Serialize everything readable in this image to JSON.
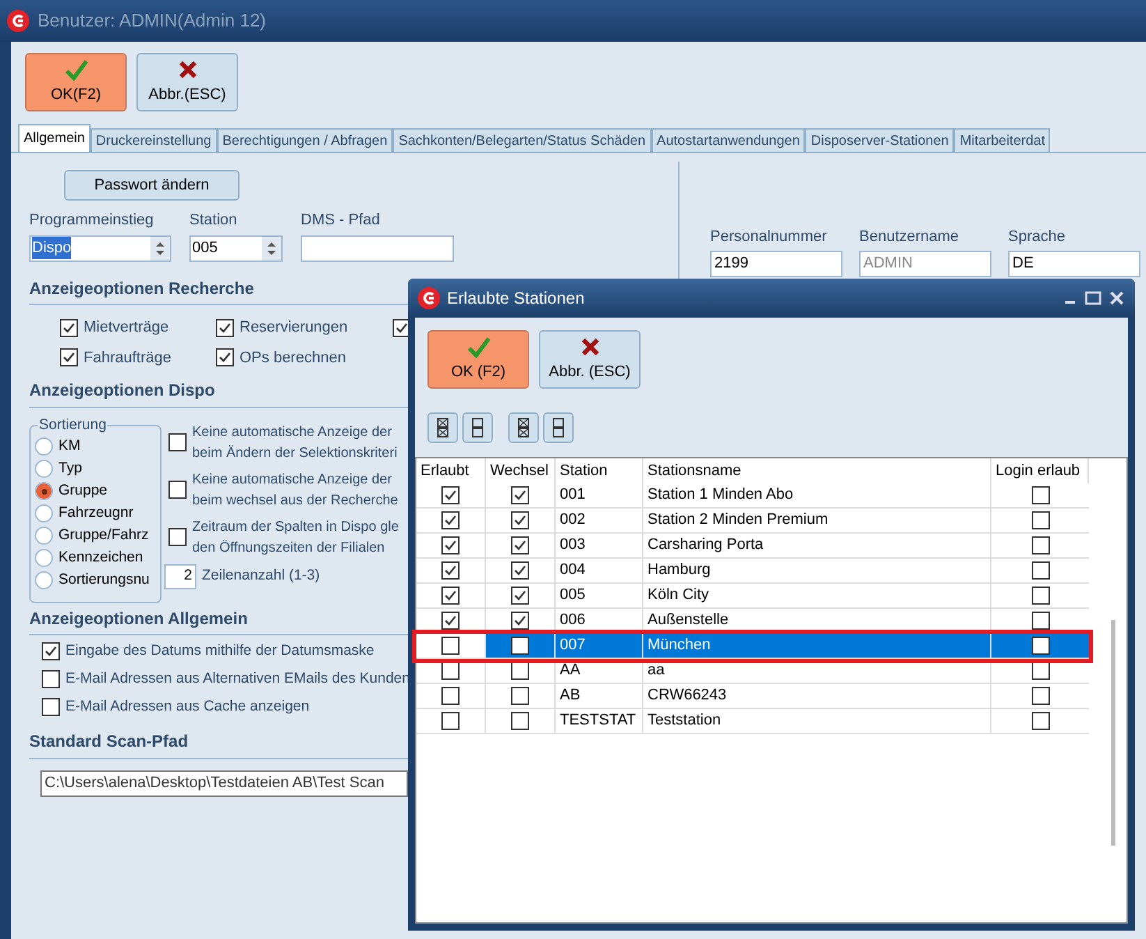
{
  "window": {
    "title": "Benutzer: ADMIN(Admin 12)"
  },
  "toolbar": [
    {
      "label": "OK(F2)",
      "kind": "ok"
    },
    {
      "label": "Abbr.(ESC)",
      "kind": "cancel"
    }
  ],
  "tabs": [
    {
      "label": "Allgemein",
      "selected": true
    },
    {
      "label": "Druckereinstellung",
      "selected": false
    },
    {
      "label": "Berechtigungen / Abfragen",
      "selected": false
    },
    {
      "label": "Sachkonten/Belegarten/Status Schäden",
      "selected": false
    },
    {
      "label": "Autostartanwendungen",
      "selected": false
    },
    {
      "label": "Disposerver-Stationen",
      "selected": false
    },
    {
      "label": "Mitarbeiterdat",
      "selected": false
    }
  ],
  "password_button": "Passwort ändern",
  "fields": [
    {
      "label": "Programmeinstieg",
      "value": "Dispo",
      "kind": "spin",
      "highlighted": true
    },
    {
      "label": "Station",
      "value": "005",
      "kind": "spin",
      "highlighted": false
    },
    {
      "label": "DMS - Pfad",
      "kind": "text",
      "highlighted": false
    }
  ],
  "recherche": {
    "heading": "Anzeigeoptionen Recherche",
    "options": [
      {
        "label": "Mietverträge",
        "checked": true
      },
      {
        "label": "Reservierungen",
        "checked": true
      },
      {
        "checked": true
      },
      {
        "label": "Fahraufträge",
        "checked": true
      },
      {
        "label": "OPs berechnen",
        "checked": true
      }
    ]
  },
  "dispo": {
    "heading": "Anzeigeoptionen Dispo",
    "sort_group": {
      "title": "Sortierung",
      "options": [
        {
          "label": "KM",
          "selected": false
        },
        {
          "label": "Typ",
          "selected": false
        },
        {
          "label": "Gruppe",
          "selected": true
        },
        {
          "label": "Fahrzeugnr",
          "selected": false
        },
        {
          "label": "Gruppe/Fahrz",
          "selected": false
        },
        {
          "label": "Kennzeichen",
          "selected": false
        },
        {
          "label": "Sortierungsnu",
          "selected": false
        }
      ]
    },
    "options": [
      {
        "lines": [
          "Keine automatische Anzeige der",
          "beim Ändern der Selektionskriteri"
        ],
        "checked": false
      },
      {
        "lines": [
          "Keine automatische Anzeige der",
          "beim wechsel aus der Recherche"
        ],
        "checked": false
      },
      {
        "lines": [
          "Zeitraum der Spalten in Dispo gle",
          "den Öffnungszeiten der Filialen"
        ],
        "checked": false
      }
    ],
    "rows_count": {
      "value": "2",
      "label": "Zeilenanzahl (1-3)"
    }
  },
  "allgemein": {
    "heading": "Anzeigeoptionen Allgemein",
    "options": [
      {
        "label": "Eingabe des Datums mithilfe der Datumsmaske",
        "checked": true
      },
      {
        "label": "E-Mail Adressen aus Alternativen EMails des Kunden",
        "checked": false
      },
      {
        "label": "E-Mail Adressen aus Cache anzeigen",
        "checked": false
      }
    ]
  },
  "scan": {
    "heading": "Standard Scan-Pfad",
    "value": "C:\\Users\\alena\\Desktop\\Testdateien AB\\Test Scan"
  },
  "personal": [
    {
      "label": "Personalnummer",
      "value": "2199",
      "disabled": false
    },
    {
      "label": "Benutzername",
      "value": "ADMIN",
      "disabled": true
    },
    {
      "label": "Sprache",
      "value": "DE",
      "disabled": false
    }
  ],
  "dialog": {
    "title": "Erlaubte Stationen",
    "buttons": [
      {
        "label": "OK (F2)",
        "kind": "ok"
      },
      {
        "label": "Abbr. (ESC)",
        "kind": "cancel"
      }
    ],
    "mark_buttons": [
      {
        "kind": "all"
      },
      {
        "kind": "none"
      },
      {
        "kind": "all"
      },
      {
        "kind": "none"
      }
    ],
    "columns": [
      "Erlaubt",
      "Wechsel",
      "Station",
      "Stationsname",
      "Login erlaub"
    ],
    "rows": [
      {
        "allowed": true,
        "switch": true,
        "station": "001",
        "name": "Station 1 Minden Abo",
        "login": false,
        "selected": false,
        "highlighted": false
      },
      {
        "allowed": true,
        "switch": true,
        "station": "002",
        "name": "Station 2 Minden Premium",
        "login": false,
        "selected": false,
        "highlighted": false
      },
      {
        "allowed": true,
        "switch": true,
        "station": "003",
        "name": "Carsharing Porta",
        "login": false,
        "selected": false,
        "highlighted": false
      },
      {
        "allowed": true,
        "switch": true,
        "station": "004",
        "name": "Hamburg",
        "login": false,
        "selected": false,
        "highlighted": false
      },
      {
        "allowed": true,
        "switch": true,
        "station": "005",
        "name": "Köln City",
        "login": false,
        "selected": false,
        "highlighted": false
      },
      {
        "allowed": true,
        "switch": true,
        "station": "006",
        "name": "Außenstelle",
        "login": false,
        "selected": false,
        "highlighted": false
      },
      {
        "allowed": false,
        "switch": false,
        "station": "007",
        "name": "München",
        "login": false,
        "selected": true,
        "highlighted": true
      },
      {
        "allowed": false,
        "switch": false,
        "station": "AA",
        "name": "aa",
        "login": false,
        "selected": false,
        "highlighted": false
      },
      {
        "allowed": false,
        "switch": false,
        "station": "AB",
        "name": "CRW66243",
        "login": false,
        "selected": false,
        "highlighted": false
      },
      {
        "allowed": false,
        "switch": false,
        "station": "TESTSTAT",
        "name": "Teststation",
        "login": false,
        "selected": false,
        "highlighted": false
      }
    ]
  }
}
